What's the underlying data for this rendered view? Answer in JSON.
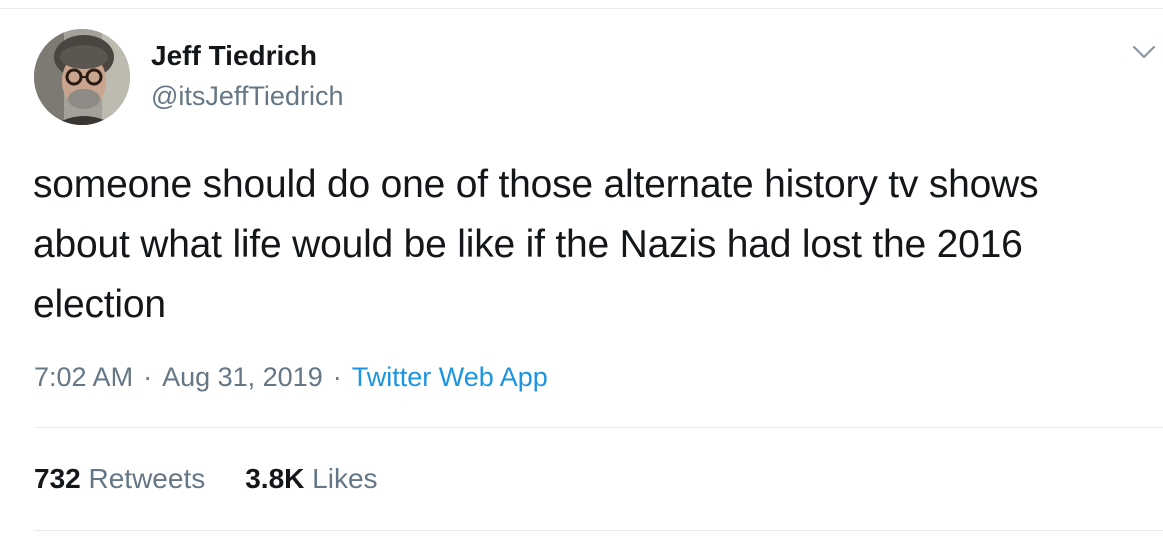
{
  "author": {
    "name": "Jeff Tiedrich",
    "handle": "@itsJeffTiedrich"
  },
  "tweet": {
    "text": "someone should do one of those alternate history tv shows about what life would be like if the Nazis had lost the 2016 election",
    "time": "7:02 AM",
    "separator": "·",
    "date": "Aug 31, 2019",
    "source": "Twitter Web App"
  },
  "stats": {
    "retweets_count": "732",
    "retweets_label": "Retweets",
    "likes_count": "3.8K",
    "likes_label": "Likes"
  },
  "icons": {
    "menu": "chevron-down-icon"
  },
  "colors": {
    "text": "#14171a",
    "secondary": "#657786",
    "link": "#1b95e0",
    "border": "#e6ecf0"
  }
}
